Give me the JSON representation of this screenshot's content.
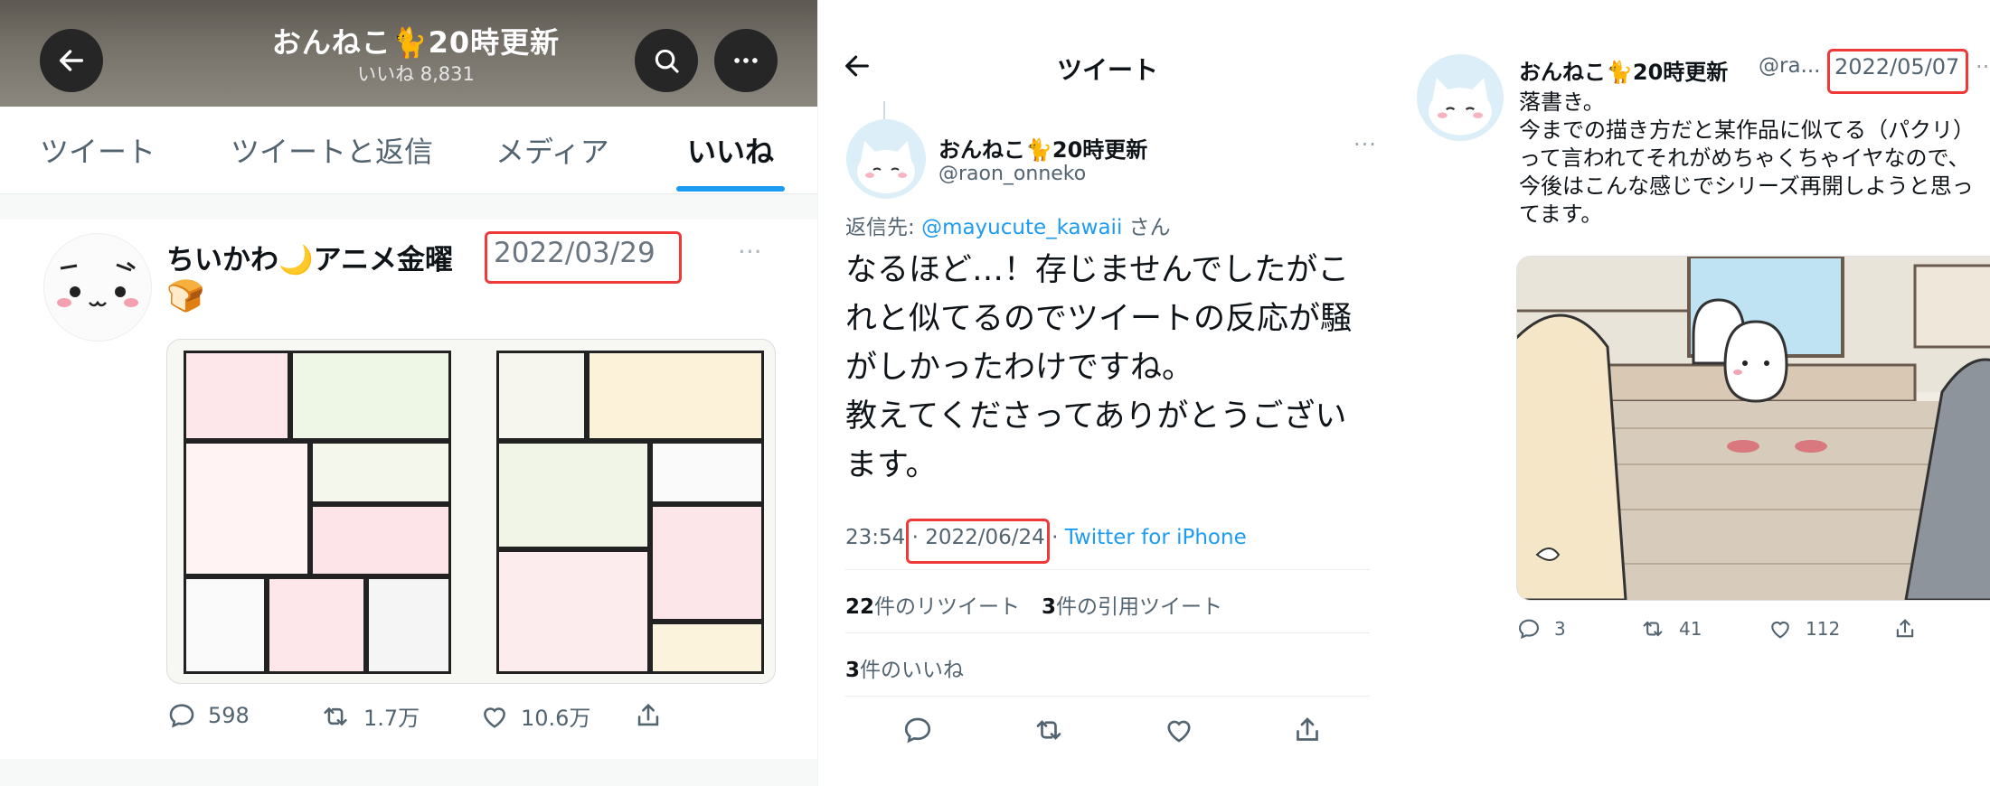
{
  "panel1": {
    "title": "おんねこ🐈20時更新",
    "subtitle": "いいね 8,831",
    "tabs": [
      {
        "label": "ツイート"
      },
      {
        "label": "ツイートと返信"
      },
      {
        "label": "メディア"
      },
      {
        "label": "いいね",
        "active": true
      }
    ],
    "tweet": {
      "name": "ちいかわ🌙アニメ金曜",
      "date": "2022/03/29",
      "body": "🍞",
      "more": "···",
      "stats": {
        "replies": "598",
        "retweets": "1.7万",
        "likes": "10.6万"
      }
    }
  },
  "panel2": {
    "header_title": "ツイート",
    "name": "おんねこ🐈20時更新",
    "handle": "@raon_onneko",
    "more": "···",
    "reply_prefix": "返信先: ",
    "reply_to": "@mayucute_kawaii",
    "reply_suffix": " さん",
    "text": "なるほど…！存じませんでしたがこ\nれと似てるのでツイートの反応が騒\nがしかったわけですね。\n教えてくださってありがとうござい\nます。",
    "time": "23:54",
    "date": "2022/06/24",
    "source": "Twitter for iPhone",
    "retweets_count": "22",
    "retweets_label": "件のリツイート",
    "quotes_count": "3",
    "quotes_label": "件の引用ツイート",
    "likes_count": "3",
    "likes_label": "件のいいね"
  },
  "panel3": {
    "name": "おんねこ🐈20時更新",
    "handle": "@ra...",
    "date": "2022/05/07",
    "more": "··",
    "text_lines": [
      "落書き。",
      "今までの描き方だと某作品に似てる（パクリ）",
      "って言われてそれがめちゃくちゃイヤなので、",
      "今後はこんな感じでシリーズ再開しようと思っ",
      "てます。"
    ],
    "stats": {
      "replies": "3",
      "retweets": "41",
      "likes": "112"
    }
  },
  "colors": {
    "accent": "#1d9bf0",
    "highlight_box": "#f03a3a",
    "text": "#0f1419",
    "secondary_text": "#536471"
  }
}
